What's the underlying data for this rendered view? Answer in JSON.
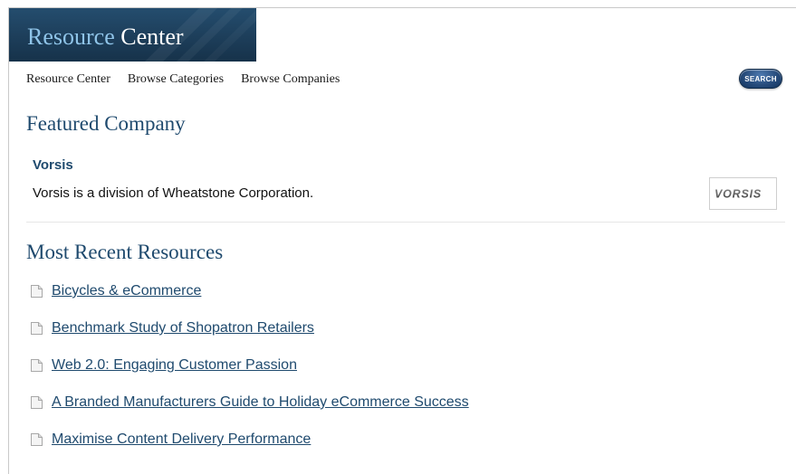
{
  "banner": {
    "title_part1": "Resource",
    "title_part2": "Center"
  },
  "nav": {
    "items": [
      {
        "label": "Resource Center"
      },
      {
        "label": "Browse Categories"
      },
      {
        "label": "Browse Companies"
      }
    ]
  },
  "search": {
    "label": "SEARCH"
  },
  "featured": {
    "heading": "Featured Company",
    "company_name": "Vorsis",
    "description": "Vorsis is a division of Wheatstone Corporation.",
    "logo_text": "VORSIS"
  },
  "recent": {
    "heading": "Most Recent Resources",
    "items": [
      {
        "label": "Bicycles & eCommerce",
        "icon": "document-icon"
      },
      {
        "label": "Benchmark Study of Shopatron Retailers",
        "icon": "document-icon"
      },
      {
        "label": "Web 2.0: Engaging Customer Passion",
        "icon": "document-icon"
      },
      {
        "label": "A Branded Manufacturers Guide to Holiday eCommerce Success",
        "icon": "document-icon"
      },
      {
        "label": "Maximise Content Delivery Performance",
        "icon": "document-icon"
      }
    ]
  },
  "colors": {
    "banner_bg": "#1d3e5a",
    "heading": "#1f4a6e",
    "link": "#1f4a6e",
    "search_button": "#274c7c"
  }
}
